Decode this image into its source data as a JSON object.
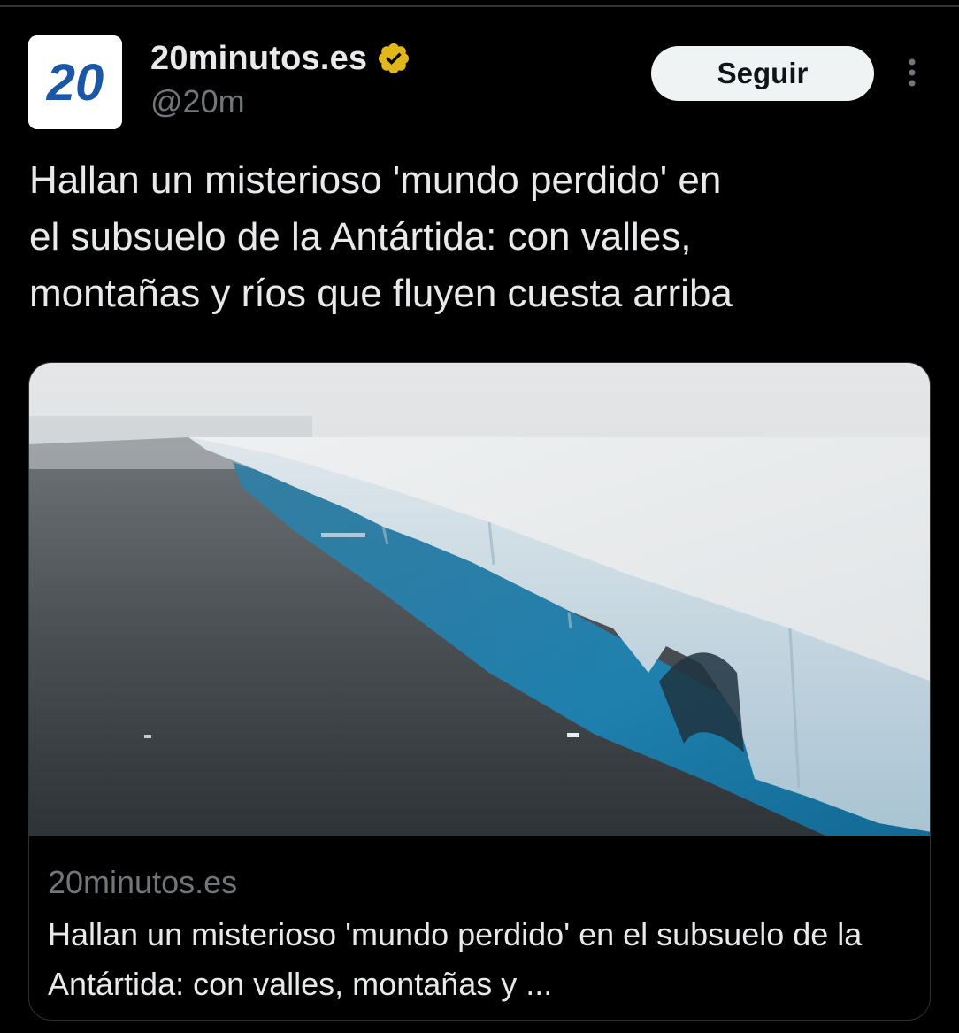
{
  "account": {
    "avatar_text": "20",
    "display_name": "20minutos.es",
    "handle": "@20m",
    "verified_icon": "verified-gold-badge-icon"
  },
  "actions": {
    "follow_label": "Seguir",
    "more_icon": "more-vertical-icon"
  },
  "tweet": {
    "text": "Hallan un misterioso 'mundo perdido' en\nel subsuelo de la Antártida: con valles,\nmontañas y ríos que fluyen cuesta arriba"
  },
  "link_card": {
    "domain": "20minutos.es",
    "title": "Hallan un misterioso 'mundo perdido' en el subsuelo de la Antártida: con valles, montañas y ..."
  },
  "colors": {
    "background": "#000000",
    "text_primary": "#e7e9ea",
    "text_secondary": "#71767b",
    "border": "#2f3336",
    "follow_button_bg": "#eff3f4",
    "brand_blue": "#1c57a5",
    "verified_gold": "#e2b719"
  }
}
